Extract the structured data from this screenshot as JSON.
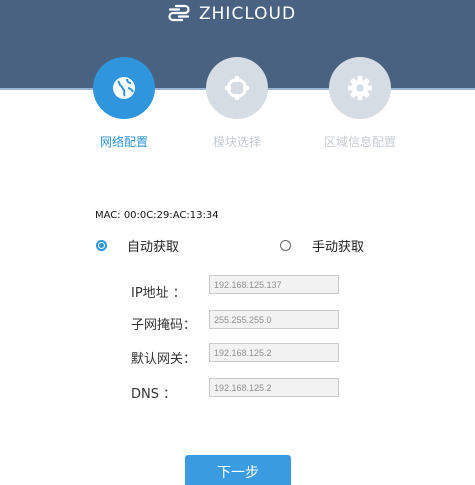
{
  "header": {
    "brand_name": "ZHICLOUD",
    "logo_icon": "zhicloud-logo-icon",
    "background_color": "#4a6282"
  },
  "steps": [
    {
      "label": "网络配置",
      "icon": "globe-icon",
      "active": true
    },
    {
      "label": "模块选择",
      "icon": "target-icon",
      "active": false
    },
    {
      "label": "区域信息配置",
      "icon": "gear-icon",
      "active": false
    }
  ],
  "colors": {
    "accent": "#2f95dc",
    "inactive_step": "#d6dce3",
    "inactive_label": "#c7ccd2"
  },
  "network": {
    "mac_text": "MAC: 00:0C:29:AC:13:34",
    "mode_options": [
      {
        "label": "自动获取",
        "selected": true
      },
      {
        "label": "手动获取",
        "selected": false
      }
    ],
    "fields": [
      {
        "label": "IP地址 ：",
        "value": "192.168.125.137"
      },
      {
        "label": "子网掩码：",
        "value": "255.255.255.0"
      },
      {
        "label": "默认网关：",
        "value": "192.168.125.2"
      },
      {
        "label": "DNS ：",
        "value": "192.168.125.2"
      }
    ]
  },
  "footer": {
    "next_label": "下一步"
  }
}
